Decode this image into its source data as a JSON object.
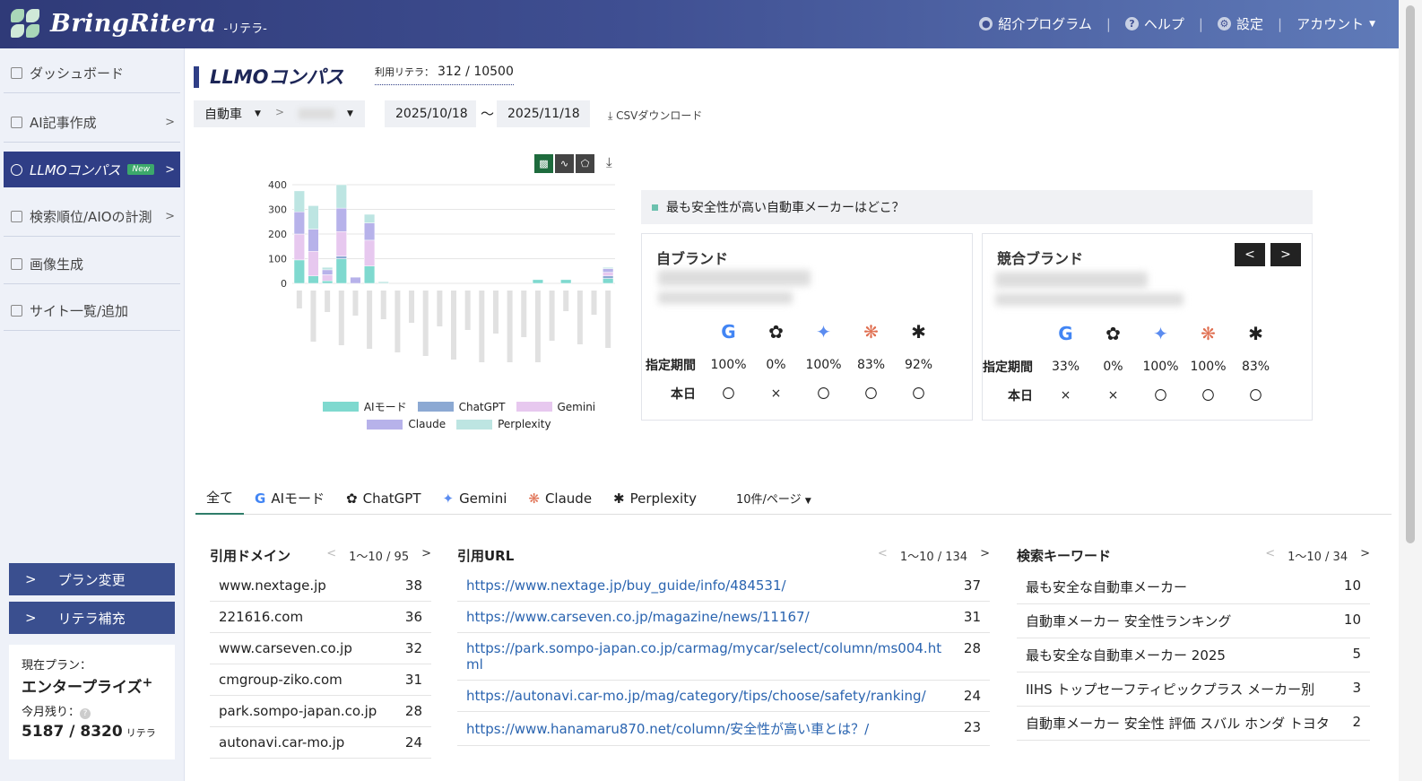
{
  "header": {
    "logo": "BringRitera",
    "logo_sub": "-リテラ-",
    "nav": [
      "紹介プログラム",
      "ヘルプ",
      "設定",
      "アカウント"
    ]
  },
  "sidebar": {
    "items": [
      {
        "label": "ダッシュボード",
        "chev": ""
      },
      {
        "label": "AI記事作成",
        "chev": ">"
      },
      {
        "label": "LLMOコンパス",
        "chev": ">",
        "badge": "New"
      },
      {
        "label": "検索順位/AIOの計測",
        "chev": ">"
      },
      {
        "label": "画像生成",
        "chev": ""
      },
      {
        "label": "サイト一覧/追加",
        "chev": ""
      }
    ],
    "plan_change": "プラン変更",
    "ritera_add": "リテラ補充",
    "plan_label": "現在プラン：",
    "plan_name": "エンタープライズ",
    "plan_plus": "+",
    "remain_label": "今月残り：",
    "remain_value": "5187",
    "remain_total": "8320",
    "remain_unit": "リテラ"
  },
  "main": {
    "title": "LLMOコンパス",
    "usage_label": "利用リテラ：",
    "usage_value": "312 / 10500",
    "category": "自動車",
    "date_from": "2025/10/18",
    "date_sep": "〜",
    "date_to": "2025/11/18",
    "csv": "CSVダウンロード",
    "question": "最も安全性が高い自動車メーカーはどこ？",
    "own_brand": "自ブランド",
    "comp_brand": "競合ブランド",
    "row_period": "指定期間",
    "row_today": "本日",
    "own_period": [
      "100%",
      "0%",
      "100%",
      "83%",
      "92%"
    ],
    "own_today": [
      "〇",
      "×",
      "〇",
      "〇",
      "〇"
    ],
    "comp_period": [
      "33%",
      "0%",
      "100%",
      "100%",
      "83%"
    ],
    "comp_today": [
      "×",
      "×",
      "〇",
      "〇",
      "〇"
    ],
    "prev": "<",
    "next": ">"
  },
  "colors": {
    "ai_mode": "#7fd9cf",
    "chatgpt": "#8ca9d3",
    "gemini": "#e7c8ef",
    "claude": "#b7b2ea",
    "perplexity": "#bde5e2"
  },
  "chart_data": {
    "type": "bar",
    "stacked": true,
    "ylim": [
      0,
      400
    ],
    "yticks": [
      "0",
      "100",
      "200",
      "300",
      "400"
    ],
    "series": [
      {
        "name": "AIモード",
        "values": [
          95,
          30,
          10,
          100,
          0,
          70,
          0,
          0,
          0,
          0,
          0,
          0,
          0,
          0,
          0,
          0,
          0,
          15,
          0,
          15,
          0,
          0,
          20
        ]
      },
      {
        "name": "ChatGPT",
        "values": [
          0,
          0,
          0,
          10,
          0,
          0,
          0,
          0,
          0,
          0,
          0,
          0,
          0,
          0,
          0,
          0,
          0,
          0,
          0,
          0,
          0,
          0,
          10
        ]
      },
      {
        "name": "Gemini",
        "values": [
          105,
          100,
          25,
          100,
          0,
          105,
          0,
          0,
          0,
          0,
          0,
          0,
          0,
          0,
          0,
          0,
          0,
          0,
          0,
          0,
          0,
          0,
          15
        ]
      },
      {
        "name": "Claude",
        "values": [
          90,
          90,
          20,
          95,
          25,
          70,
          0,
          0,
          0,
          0,
          0,
          0,
          0,
          0,
          0,
          0,
          0,
          0,
          0,
          0,
          0,
          0,
          15
        ]
      },
      {
        "name": "Perplexity",
        "values": [
          85,
          95,
          10,
          95,
          0,
          35,
          7,
          0,
          0,
          0,
          0,
          0,
          0,
          0,
          0,
          0,
          0,
          0,
          0,
          0,
          0,
          0,
          5
        ]
      }
    ]
  },
  "tabs": [
    "全て",
    "AIモード",
    "ChatGPT",
    "Gemini",
    "Claude",
    "Perplexity"
  ],
  "perpage": "10件/ページ",
  "domains": {
    "title": "引用ドメイン",
    "pager": "1～10 / 95",
    "rows": [
      {
        "k": "www.nextage.jp",
        "v": "38"
      },
      {
        "k": "221616.com",
        "v": "36"
      },
      {
        "k": "www.carseven.co.jp",
        "v": "32"
      },
      {
        "k": "cmgroup-ziko.com",
        "v": "31"
      },
      {
        "k": "park.sompo-japan.co.jp",
        "v": "28"
      },
      {
        "k": "autonavi.car-mo.jp",
        "v": "24"
      }
    ]
  },
  "urls": {
    "title": "引用URL",
    "pager": "1～10 / 134",
    "rows": [
      {
        "k": "https://www.nextage.jp/buy_guide/info/484531/",
        "v": "37"
      },
      {
        "k": "https://www.carseven.co.jp/magazine/news/11167/",
        "v": "31"
      },
      {
        "k": "https://park.sompo-japan.co.jp/carmag/mycar/select/column/ms004.html",
        "v": "28"
      },
      {
        "k": "https://autonavi.car-mo.jp/mag/category/tips/choose/safety/ranking/",
        "v": "24"
      },
      {
        "k": "https://www.hanamaru870.net/column/安全性が高い車とは？/",
        "v": "23"
      }
    ]
  },
  "keywords": {
    "title": "検索キーワード",
    "pager": "1～10 / 34",
    "rows": [
      {
        "k": "最も安全な自動車メーカー",
        "v": "10"
      },
      {
        "k": "自動車メーカー 安全性ランキング",
        "v": "10"
      },
      {
        "k": "最も安全な自動車メーカー 2025",
        "v": "5"
      },
      {
        "k": "IIHS トップセーフティピックプラス メーカー別",
        "v": "3"
      },
      {
        "k": "自動車メーカー 安全性 評価 スバル ホンダ トヨタ",
        "v": "2"
      }
    ]
  }
}
